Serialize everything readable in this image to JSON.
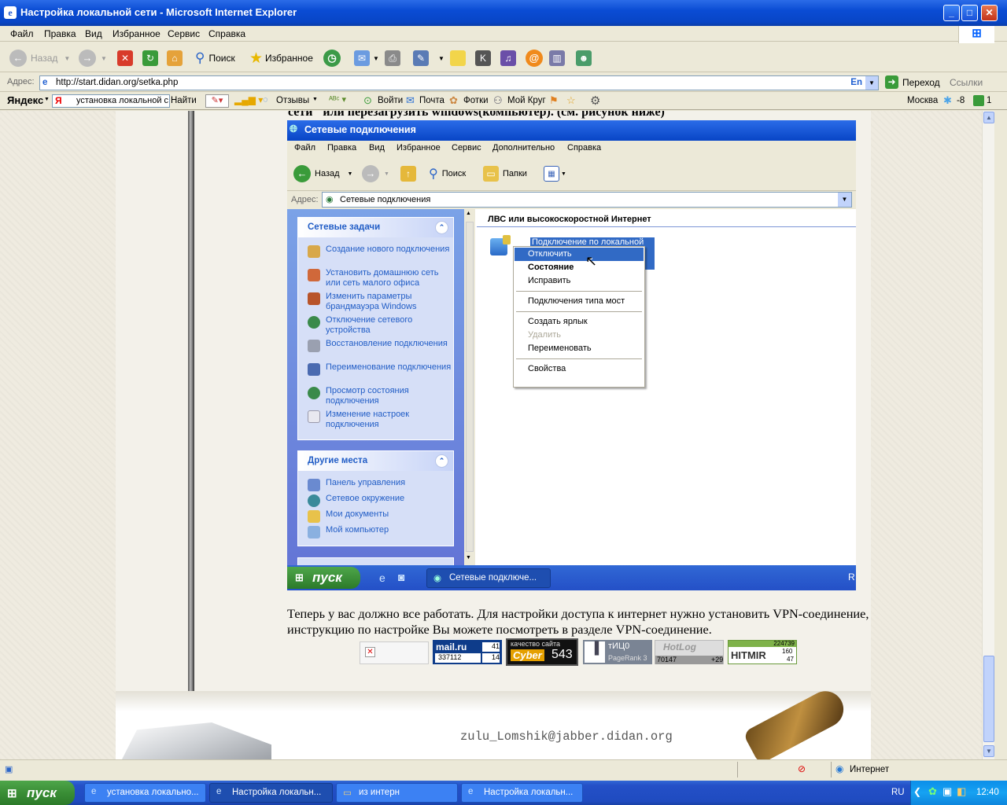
{
  "window": {
    "title": "Настройка локальной сети - Microsoft Internet Explorer"
  },
  "menu": [
    "Файл",
    "Правка",
    "Вид",
    "Избранное",
    "Сервис",
    "Справка"
  ],
  "toolbar": {
    "back": "Назад",
    "search": "Поиск",
    "favorites": "Избранное"
  },
  "address": {
    "label": "Адрес:",
    "url": "http://start.didan.org/setka.php",
    "lang": "En",
    "go": "Переход",
    "links": "Ссылки"
  },
  "yandex": {
    "logo": "Яндекс",
    "query": "установка локальной с",
    "find": "Найти",
    "reviews": "Отзывы",
    "login": "Войти",
    "mail": "Почта",
    "photos": "Фотки",
    "circle": "Мой Круг",
    "city": "Москва",
    "temp": "-8",
    "count": "1"
  },
  "page": {
    "top_text": "сети\" или перезагрузить windows(компьютер). (см. рисунок ниже)",
    "para": "Теперь у вас должно все работать. Для настройки доступа к интернет нужно установить VPN-соединение, инструкцию по настройке Вы можете посмотреть в разделе VPN-соединение.",
    "jabber": "zulu_Lomshik@jabber.didan.org",
    "counters": {
      "mailru": {
        "logo": "mail.ru",
        "total": "337112",
        "a": "41",
        "b": "14"
      },
      "cyber": {
        "label": "качество сайта",
        "brand": "Cyber",
        "value": "543"
      },
      "tic": {
        "label": "тИЦ0",
        "sub": "PageRank 3"
      },
      "hotlog": {
        "brand": "HotLog",
        "total": "70147",
        "delta": "+29"
      },
      "hitmir": {
        "brand": "HITMIR",
        "total": "224739",
        "a": "160",
        "b": "47"
      }
    }
  },
  "shot": {
    "title": "Сетевые подключения",
    "menu": [
      "Файл",
      "Правка",
      "Вид",
      "Избранное",
      "Сервис",
      "Дополнительно",
      "Справка"
    ],
    "toolbar": {
      "back": "Назад",
      "search": "Поиск",
      "folders": "Папки"
    },
    "address_label": "Адрес:",
    "address": "Сетевые подключения",
    "tasks_title": "Сетевые задачи",
    "tasks": [
      "Создание нового подключения",
      "Установить домашнюю сеть или сеть малого офиса",
      "Изменить параметры брандмауэра Windows",
      "Отключение сетевого устройства",
      "Восстановление подключения",
      "Переименование подключения",
      "Просмотр состояния подключения",
      "Изменение настроек подключения"
    ],
    "places_title": "Другие места",
    "places": [
      "Панель управления",
      "Сетевое окружение",
      "Мои документы",
      "Мой компьютер"
    ],
    "group": "ЛВС или высокоскоростной Интернет",
    "connection": "Подключение по локальной",
    "context": [
      "Отключить",
      "Состояние",
      "Исправить",
      "Подключения типа мост",
      "Создать ярлык",
      "Удалить",
      "Переименовать",
      "Свойства"
    ],
    "start": "пуск",
    "task": "Сетевые подключе...",
    "tray_letter": "R"
  },
  "status": {
    "zone": "Интернет"
  },
  "taskbar": {
    "start": "пуск",
    "items": [
      "установка локально...",
      "Настройка локальн...",
      "из интерн",
      "Настройка локальн..."
    ],
    "lang": "RU",
    "clock": "12:40"
  }
}
